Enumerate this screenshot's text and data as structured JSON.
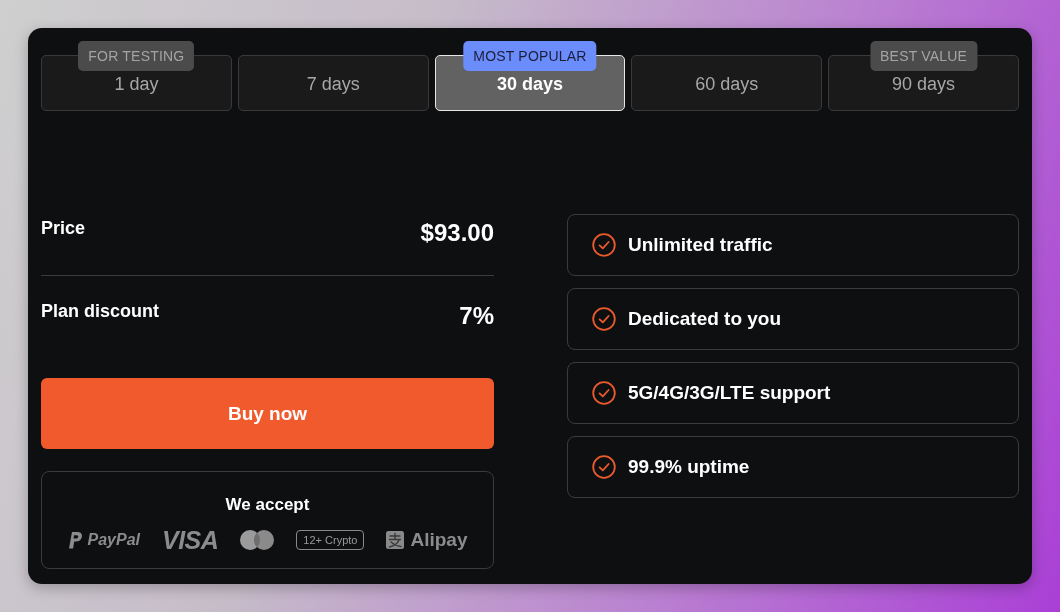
{
  "tabs": [
    {
      "label": "1 day",
      "selected": false,
      "badge": {
        "text": "FOR TESTING",
        "kind": "muted"
      }
    },
    {
      "label": "7 days",
      "selected": false
    },
    {
      "label": "30 days",
      "selected": true,
      "badge": {
        "text": "MOST POPULAR",
        "kind": "accent"
      }
    },
    {
      "label": "60 days",
      "selected": false
    },
    {
      "label": "90 days",
      "selected": false,
      "badge": {
        "text": "BEST VALUE",
        "kind": "muted"
      }
    }
  ],
  "summary": [
    {
      "label": "Price",
      "value": "$93.00"
    },
    {
      "label": "Plan discount",
      "value": "7%"
    }
  ],
  "buy_button": {
    "label": "Buy now"
  },
  "payment": {
    "title": "We accept",
    "methods": [
      {
        "kind": "paypal",
        "label": "PayPal"
      },
      {
        "kind": "visa",
        "label": "VISA"
      },
      {
        "kind": "mastercard"
      },
      {
        "kind": "crypto",
        "label": "12+ Crypto"
      },
      {
        "kind": "alipay",
        "label": "Alipay"
      }
    ]
  },
  "features": [
    "Unlimited traffic",
    "Dedicated to you",
    "5G/4G/3G/LTE support",
    "99.9% uptime"
  ]
}
